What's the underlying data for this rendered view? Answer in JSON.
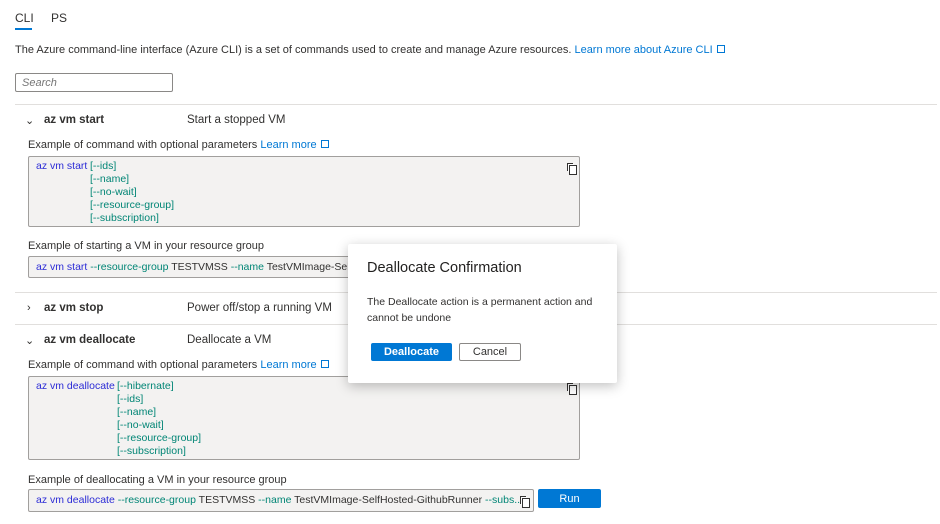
{
  "tabs": [
    {
      "label": "CLI",
      "active": true
    },
    {
      "label": "PS",
      "active": false
    }
  ],
  "intro": {
    "text": "The Azure command-line interface (Azure CLI) is a set of commands used to create and manage Azure resources.",
    "link": "Learn more about Azure CLI"
  },
  "search": {
    "placeholder": "Search"
  },
  "sections": [
    {
      "name": "az vm start",
      "description": "Start a stopped VM",
      "expanded": true,
      "example_label": "Example of command with optional parameters",
      "learn_more": "Learn more",
      "syntax": {
        "cmd": "az vm start",
        "params": [
          "[--ids]",
          "[--name]",
          "[--no-wait]",
          "[--resource-group]",
          "[--subscription]"
        ]
      },
      "rg_label": "Example of starting a VM in your resource group",
      "rg_example": {
        "cmd": "az vm start",
        "p1": "--resource-group",
        "v1": "TESTVMSS",
        "p2": "--name",
        "v2": "TestVMImage-SelfH"
      }
    },
    {
      "name": "az vm stop",
      "description": "Power off/stop a running VM",
      "expanded": false
    },
    {
      "name": "az vm deallocate",
      "description": "Deallocate a VM",
      "expanded": true,
      "example_label": "Example of command with optional parameters",
      "learn_more": "Learn more",
      "syntax": {
        "cmd": "az vm deallocate",
        "params": [
          "[--hibernate]",
          "[--ids]",
          "[--name]",
          "[--no-wait]",
          "[--resource-group]",
          "[--subscription]"
        ]
      },
      "rg_label": "Example of deallocating a VM in your resource group",
      "rg_example": {
        "cmd": "az vm deallocate",
        "p1": "--resource-group",
        "v1": "TESTVMSS",
        "p2": "--name",
        "v2": "TestVMImage-SelfHosted-GithubRunner",
        "p3": "--subs..."
      },
      "run_label": "Run"
    }
  ],
  "dialog": {
    "title": "Deallocate Confirmation",
    "message": "The Deallocate action is a permanent action and cannot be undone",
    "confirm": "Deallocate",
    "cancel": "Cancel"
  }
}
